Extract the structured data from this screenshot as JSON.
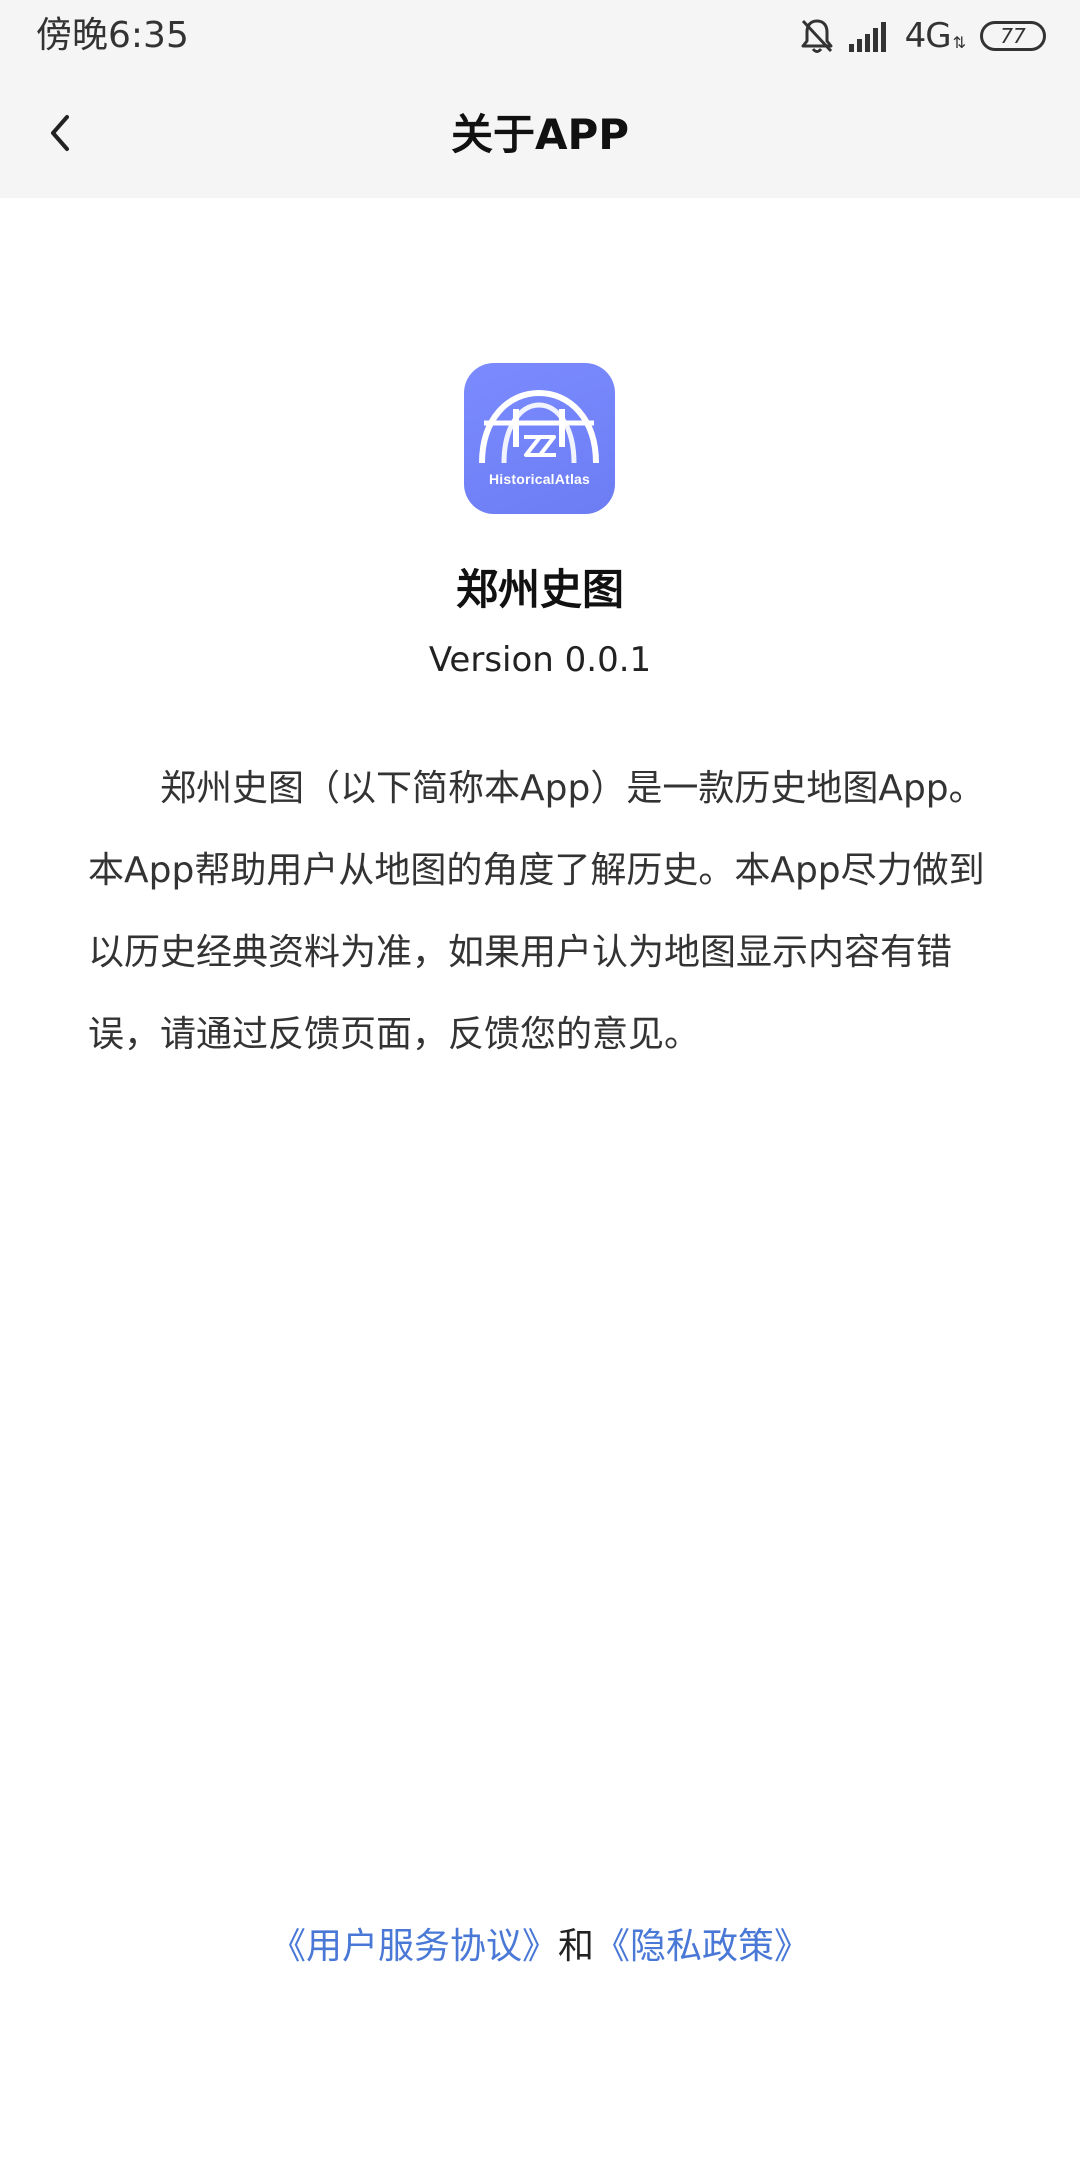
{
  "status_bar": {
    "time": "傍晚6:35",
    "network": "4G",
    "battery": "77",
    "icons": [
      "bell-muted-icon",
      "signal-icon",
      "battery-icon"
    ]
  },
  "header": {
    "title": "关于APP",
    "back_icon": "chevron-left-icon"
  },
  "app": {
    "icon_text": "HistoricalAtlas",
    "icon_color": "#7585f7",
    "name": "郑州史图",
    "version": "Version 0.0.1",
    "description": "郑州史图（以下简称本App）是一款历史地图App。本App帮助用户从地图的角度了解历史。本App尽力做到以历史经典资料为准，如果用户认为地图显示内容有错误，请通过反馈页面，反馈您的意见。"
  },
  "footer": {
    "user_agreement_link": "《用户服务协议》",
    "and_text": "和",
    "privacy_policy_link": "《隐私政策》",
    "link_color": "#4a78d6"
  }
}
